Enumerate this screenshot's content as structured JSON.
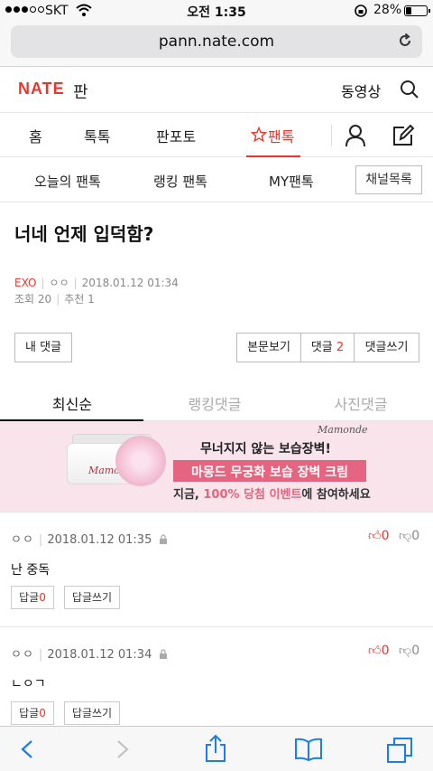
{
  "status": {
    "carrier": "SKT",
    "time": "오전 1:35",
    "battery": "28%",
    "battery_level": 0.28
  },
  "browser": {
    "url": "pann.nate.com"
  },
  "header": {
    "logo": "NATE",
    "logo_suffix": "판",
    "video": "동영상"
  },
  "nav": {
    "items": [
      "홈",
      "톡톡",
      "판포토",
      "팬톡"
    ],
    "active": "팬톡"
  },
  "subnav": {
    "items": [
      "오늘의 팬톡",
      "랭킹 팬톡",
      "MY팬톡"
    ],
    "channel_button": "채널목록"
  },
  "post": {
    "title": "너네 언제 입덕함?",
    "channel": "EXO",
    "author": "ㅇㅇ",
    "datetime": "2018.01.12 01:34",
    "views_label": "조회",
    "views": "20",
    "recommend_label": "추천",
    "recommend": "1"
  },
  "actions": {
    "my_comments": "내 댓글",
    "view_post": "본문보기",
    "comments_label": "댓글",
    "comments_count": "2",
    "write_comment": "댓글쓰기"
  },
  "tabs": [
    "최신순",
    "랭킹댓글",
    "사진댓글"
  ],
  "ad": {
    "brand": "Mamonde",
    "jar_brand": "Mamonde",
    "line1": "무너지지 않는 보습장벽!",
    "line2": "마몽드 무궁화 보습 장벽 크림",
    "line3_pre": "지금, ",
    "line3_red": "100% 당첨 이벤트",
    "line3_post": "에 참여하세요"
  },
  "comments": [
    {
      "author": "ㅇㅇ",
      "datetime": "2018.01.12 01:35",
      "up": "0",
      "down": "0",
      "text": "난 중독",
      "reply_label": "답글",
      "reply_count": "0",
      "write_reply": "답글쓰기"
    },
    {
      "author": "ㅇㅇ",
      "datetime": "2018.01.12 01:34",
      "up": "0",
      "down": "0",
      "text": "ㄴㅇㄱ",
      "reply_label": "답글",
      "reply_count": "0",
      "write_reply": "답글쓰기"
    }
  ]
}
